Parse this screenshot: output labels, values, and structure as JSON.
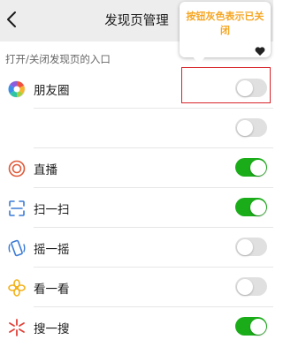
{
  "header": {
    "title": "发现页管理",
    "back_icon": "chevron-left-icon"
  },
  "section_label": "打开/关闭发现页的入口",
  "rows": [
    {
      "label": "朋友圈",
      "icon": "moments-icon",
      "enabled": false
    },
    {
      "label": "",
      "icon": "",
      "enabled": false
    },
    {
      "label": "直播",
      "icon": "live-icon",
      "enabled": true
    },
    {
      "label": "扫一扫",
      "icon": "scan-icon",
      "enabled": true
    },
    {
      "label": "摇一摇",
      "icon": "shake-icon",
      "enabled": false
    },
    {
      "label": "看一看",
      "icon": "top-stories-icon",
      "enabled": false
    },
    {
      "label": "搜一搜",
      "icon": "search-icon",
      "enabled": true
    }
  ],
  "callout": {
    "text": "按钮灰色表示已关闭",
    "icon": "heart-icon"
  },
  "colors": {
    "toggle_on": "#1aad19",
    "toggle_off": "#e0e0e0",
    "highlight": "#d8232a",
    "callout_text": "#f5a623"
  }
}
